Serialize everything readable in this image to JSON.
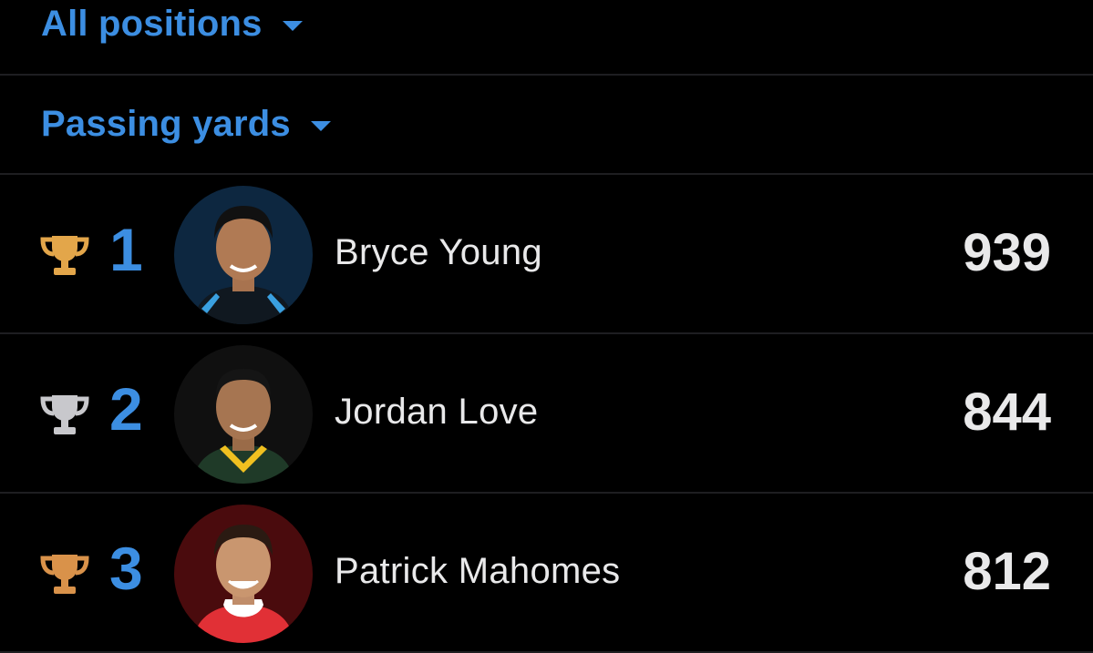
{
  "filters": {
    "position": "All positions",
    "stat": "Passing yards"
  },
  "colors": {
    "accent": "#3c8ee2",
    "gold": "#e3a64a",
    "silver": "#c8c8cc",
    "bronze": "#d9924a",
    "background": "#000000",
    "divider": "#1e1e21"
  },
  "leaders": [
    {
      "rank": "1",
      "name": "Bryce Young",
      "value": "939",
      "trophy": "gold-trophy-icon",
      "avatar_bg": "#0d2740",
      "jersey": "#101820",
      "trim": "#3aa0e0"
    },
    {
      "rank": "2",
      "name": "Jordan Love",
      "value": "844",
      "trophy": "silver-trophy-icon",
      "avatar_bg": "#101010",
      "jersey": "#1f3a28",
      "trim": "#f0c020"
    },
    {
      "rank": "3",
      "name": "Patrick Mahomes",
      "value": "812",
      "trophy": "bronze-trophy-icon",
      "avatar_bg": "#4a0b0d",
      "jersey": "#e13036",
      "trim": "#ffffff"
    }
  ]
}
